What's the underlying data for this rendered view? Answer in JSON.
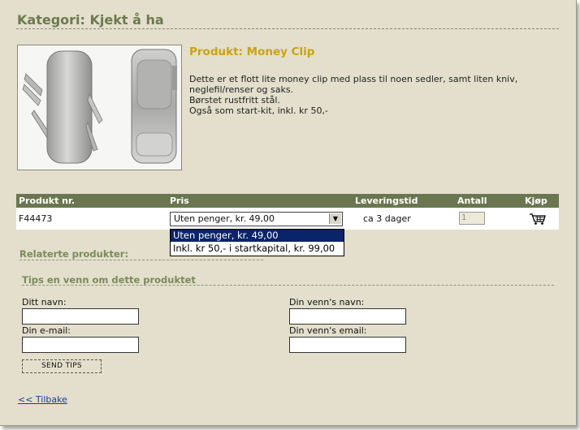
{
  "category": {
    "title": "Kategori: Kjekt å ha"
  },
  "product": {
    "title": "Produkt: Money Clip",
    "description": [
      "Dette er et flott lite money clip med plass til noen sedler, samt liten kniv,",
      "neglefil/renser og saks.",
      "Børstet rustfritt stål.",
      "Også som start-kit, inkl. kr 50,-"
    ]
  },
  "table": {
    "headers": {
      "product_no": "Produkt nr.",
      "price": "Pris",
      "delivery": "Leveringstid",
      "quantity": "Antall",
      "buy": "Kjøp"
    },
    "row": {
      "product_no": "F44473",
      "price_selected": "Uten penger, kr. 49,00",
      "delivery": "ca 3 dager",
      "quantity": "1"
    }
  },
  "price_options": [
    {
      "label": "Uten penger, kr. 49,00",
      "selected": true
    },
    {
      "label": "Inkl. kr 50,- i startkapital, kr. 99,00",
      "selected": false
    }
  ],
  "related": {
    "title": "Relaterte produkter:"
  },
  "tips": {
    "title": "Tips en venn om dette produktet",
    "your_name_label": "Ditt navn:",
    "your_email_label": "Din e-mail:",
    "friend_name_label": "Din venn's navn:",
    "friend_email_label": "Din venn's email:",
    "send_label": "SEND TIPS"
  },
  "back_link": "<< Tilbake",
  "icons": {
    "cart": "shopping-cart-icon",
    "dropdown": "chevron-down-icon"
  },
  "colors": {
    "background": "#e3dfcc",
    "header_bar": "#6b7650",
    "heading": "#6b7a4e",
    "product_title": "#c9a312",
    "selection": "#0a246a"
  }
}
